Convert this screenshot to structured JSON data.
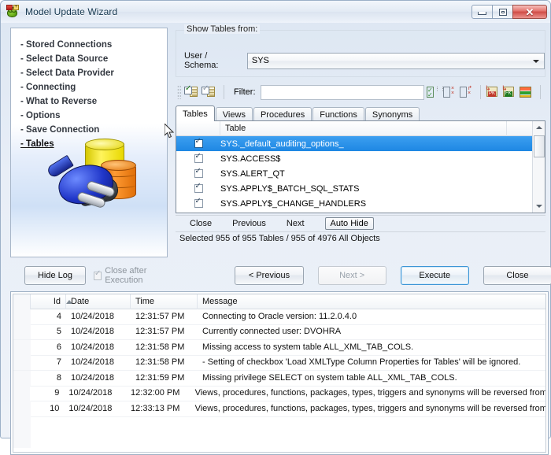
{
  "window": {
    "title": "Model Update Wizard",
    "app_icon": "frog-wizard-icon",
    "minimize_label": "",
    "maximize_label": "",
    "close_label": "✕"
  },
  "steps": {
    "items": [
      {
        "label": "- Stored Connections",
        "current": false
      },
      {
        "label": "- Select Data Source",
        "current": false
      },
      {
        "label": "- Select Data Provider",
        "current": false
      },
      {
        "label": "- Connecting",
        "current": false
      },
      {
        "label": "- What to Reverse",
        "current": false
      },
      {
        "label": "- Options",
        "current": false
      },
      {
        "label": "- Save Connection",
        "current": false
      },
      {
        "label": "- Tables",
        "current": true
      }
    ]
  },
  "show_tables": {
    "legend": "Show Tables from:",
    "schema_label": "User / Schema:",
    "schema_value": "SYS"
  },
  "toolbar": {
    "filter_label": "Filter:",
    "filter_value": "",
    "filter_placeholder": "",
    "icons": [
      "check-selected-icon",
      "uncheck-selected-icon",
      "select-all-columns-icon",
      "deselect-all-columns-icon",
      "invert-selection-icon",
      "primary-key-icon",
      "foreign-key-icon",
      "all-keys-icon"
    ]
  },
  "tabs": [
    {
      "label": "Tables",
      "active": true
    },
    {
      "label": "Views",
      "active": false
    },
    {
      "label": "Procedures",
      "active": false
    },
    {
      "label": "Functions",
      "active": false
    },
    {
      "label": "Synonyms",
      "active": false
    }
  ],
  "table_list": {
    "column_header": "Table",
    "rows": [
      {
        "checked": true,
        "name": "SYS._default_auditing_options_",
        "selected": true
      },
      {
        "checked": true,
        "name": "SYS.ACCESS$",
        "selected": false
      },
      {
        "checked": true,
        "name": "SYS.ALERT_QT",
        "selected": false
      },
      {
        "checked": true,
        "name": "SYS.APPLY$_BATCH_SQL_STATS",
        "selected": false
      },
      {
        "checked": true,
        "name": "SYS.APPLY$_CHANGE_HANDLERS",
        "selected": false
      }
    ]
  },
  "dock": {
    "close": "Close",
    "previous": "Previous",
    "next": "Next",
    "auto_hide": "Auto Hide"
  },
  "status": {
    "text": "Selected 955 of 955 Tables / 955 of 4976 All Objects"
  },
  "actions": {
    "hide_log": "Hide Log",
    "close_after_execution": "Close after Execution",
    "close_after_execution_checked": true,
    "previous": "< Previous",
    "next": "Next >",
    "execute": "Execute",
    "close": "Close"
  },
  "log": {
    "columns": [
      "Id",
      "Date",
      "Time",
      "Message"
    ],
    "sort_column": "Id",
    "sort_direction": "asc",
    "rows": [
      {
        "id": "4",
        "date": "10/24/2018",
        "time": "12:31:57 PM",
        "message": "Connecting to Oracle version: 11.2.0.4.0"
      },
      {
        "id": "5",
        "date": "10/24/2018",
        "time": "12:31:57 PM",
        "message": "Currently connected user: DVOHRA"
      },
      {
        "id": "6",
        "date": "10/24/2018",
        "time": "12:31:58 PM",
        "message": "Missing access to system table ALL_XML_TAB_COLS."
      },
      {
        "id": "7",
        "date": "10/24/2018",
        "time": "12:31:58 PM",
        "message": " - Setting of checkbox 'Load XMLType Column Properties for Tables' will be ignored."
      },
      {
        "id": "8",
        "date": "10/24/2018",
        "time": "12:31:59 PM",
        "message": "Missing privilege SELECT on system table ALL_XML_TAB_COLS."
      },
      {
        "id": "9",
        "date": "10/24/2018",
        "time": "12:32:00 PM",
        "message": "Views, procedures, functions, packages, types, triggers and synonyms will be reversed from e..."
      },
      {
        "id": "10",
        "date": "10/24/2018",
        "time": "12:33:13 PM",
        "message": "Views, procedures, functions, packages, types, triggers and synonyms will be reversed from e..."
      }
    ]
  },
  "colors": {
    "selection_blue": "#1e87e3",
    "default_button_border": "#3d96d6",
    "close_button_red": "#cf4b45",
    "title_text": "#15374f"
  }
}
